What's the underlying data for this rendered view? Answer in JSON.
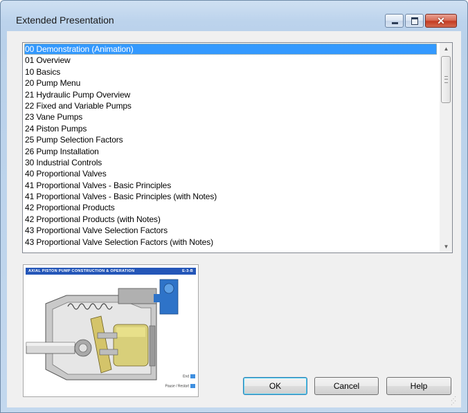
{
  "window": {
    "title": "Extended Presentation",
    "close_glyph": "✕"
  },
  "list": {
    "selected_index": 0,
    "items": [
      "00 Demonstration (Animation)",
      "01 Overview",
      "10 Basics",
      "20 Pump Menu",
      "21 Hydraulic Pump Overview",
      "22 Fixed and Variable Pumps",
      "23 Vane Pumps",
      "24 Piston Pumps",
      "25 Pump Selection Factors",
      "26 Pump Installation",
      "30 Industrial Controls",
      "40 Proportional Valves",
      "41 Proportional Valves - Basic Principles",
      "41 Proportional Valves - Basic Principles (with Notes)",
      "42 Proportional Products",
      "42 Proportional Products (with Notes)",
      "43 Proportional Valve Selection Factors",
      "43 Proportional Valve Selection Factors (with Notes)"
    ]
  },
  "scrollbar": {
    "up_arrow": "▲",
    "down_arrow": "▼"
  },
  "preview": {
    "banner_title": "AXIAL PISTON PUMP CONSTRUCTION & OPERATION",
    "banner_code": "E-3-B",
    "legend_end": "End",
    "legend_pause": "Pause / Restart"
  },
  "buttons": {
    "ok": "OK",
    "cancel": "Cancel",
    "help": "Help"
  },
  "colors": {
    "selection": "#3399ff",
    "title_bar": "#bcd3ec",
    "close_button": "#c43b22",
    "banner": "#2456b8"
  }
}
